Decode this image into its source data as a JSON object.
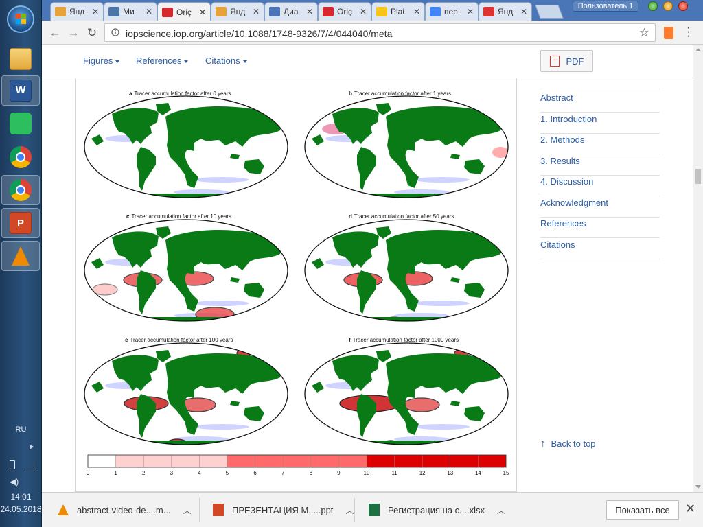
{
  "taskbar": {
    "lang": "RU",
    "time": "14:01",
    "date": "24.05.2018"
  },
  "tabs": [
    {
      "label": "Янд",
      "icon": "mail-icon",
      "color": "#e8a23a"
    },
    {
      "label": "Ми",
      "icon": "vk-icon",
      "color": "#4a76a8"
    },
    {
      "label": "Oriç",
      "icon": "iop-icon",
      "color": "#d6282e",
      "active": true
    },
    {
      "label": "Янд",
      "icon": "mail-icon",
      "color": "#e8a23a"
    },
    {
      "label": "Диа",
      "icon": "chat-icon",
      "color": "#4a76b8"
    },
    {
      "label": "Oriç",
      "icon": "iop-icon",
      "color": "#d6282e"
    },
    {
      "label": "Plai",
      "icon": "doc-icon",
      "color": "#f5c518"
    },
    {
      "label": "пер",
      "icon": "google-icon",
      "color": "#4285f4"
    },
    {
      "label": "Янд",
      "icon": "yandex-icon",
      "color": "#d33"
    }
  ],
  "user_badge": "Пользователь 1",
  "address": {
    "url": "iopscience.iop.org/article/10.1088/1748-9326/7/4/044040/meta"
  },
  "page_nav": {
    "figures": "Figures",
    "references": "References",
    "citations": "Citations",
    "pdf": "PDF"
  },
  "figure": {
    "panels": [
      {
        "letter": "a",
        "title": "Tracer accumulation factor after 0 years"
      },
      {
        "letter": "b",
        "title": "Tracer accumulation factor after 1 years"
      },
      {
        "letter": "c",
        "title": "Tracer accumulation factor after 10 years"
      },
      {
        "letter": "d",
        "title": "Tracer accumulation factor after 50 years"
      },
      {
        "letter": "e",
        "title": "Tracer accumulation factor after 100 years"
      },
      {
        "letter": "f",
        "title": "Tracer accumulation factor after 1000 years"
      }
    ],
    "colorbar": {
      "ticks": [
        "0",
        "1",
        "2",
        "3",
        "4",
        "5",
        "6",
        "7",
        "8",
        "9",
        "10",
        "11",
        "12",
        "13",
        "14",
        "15"
      ],
      "colors": [
        "#ffffff",
        "#ffd0d0",
        "#ffd0d0",
        "#ffd0d0",
        "#ffd0d0",
        "#ff6a6a",
        "#ff6a6a",
        "#ff6a6a",
        "#ff6a6a",
        "#ff6a6a",
        "#dd0000",
        "#dd0000",
        "#dd0000",
        "#dd0000",
        "#dd0000"
      ]
    },
    "land_color": "#0a7a16",
    "ocean_color": "#ffffff"
  },
  "toc": {
    "items": [
      "Abstract",
      "1. Introduction",
      "2. Methods",
      "3. Results",
      "4. Discussion",
      "Acknowledgment",
      "References",
      "Citations"
    ],
    "back_to_top": "Back to top"
  },
  "downloads": {
    "items": [
      {
        "name": "abstract-video-de....m...",
        "icon": "vlc-icon"
      },
      {
        "name": "ПРЕЗЕНТАЦИЯ М.....ppt",
        "icon": "ppt-icon"
      },
      {
        "name": "Регистрация на с....xlsx",
        "icon": "xlsx-icon"
      }
    ],
    "show_all": "Показать все"
  }
}
